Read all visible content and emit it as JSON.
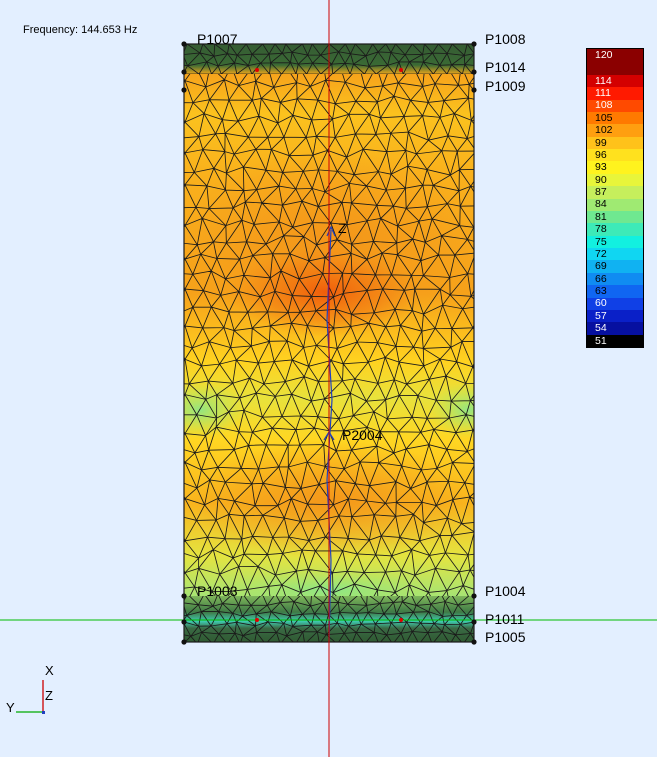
{
  "viewer": {
    "frequency_label": "Frequency: 144.653 Hz",
    "colors": {
      "background": "#e3efff",
      "mesh_line": "#1a1a1a",
      "crosshair_vertical": "#cc0000",
      "crosshair_horizontal": "#00bb00",
      "axis_line": "#2040c0",
      "hot": "#f26a10",
      "warm": "#f59a1a",
      "mid": "#ffd21e",
      "cool": "#c8e64a",
      "cold": "#7fe58a",
      "band_dark": "#2f5a32"
    }
  },
  "points": [
    {
      "name": "P1007"
    },
    {
      "name": "P1008"
    },
    {
      "name": "P1014"
    },
    {
      "name": "P1009"
    },
    {
      "name": "Z"
    },
    {
      "name": "P2004"
    },
    {
      "name": "P1003"
    },
    {
      "name": "P1004"
    },
    {
      "name": "P1011"
    },
    {
      "name": "P1005"
    }
  ],
  "legend": {
    "entries": [
      {
        "label": "120",
        "color": "#8b0000",
        "text_color": "#ffffff"
      },
      {
        "label": "114",
        "color": "#d40000",
        "text_color": "#ffffff"
      },
      {
        "label": "111",
        "color": "#ff1a00",
        "text_color": "#ffffff"
      },
      {
        "label": "108",
        "color": "#ff4a00",
        "text_color": "#ffffff"
      },
      {
        "label": "105",
        "color": "#ff7a00",
        "text_color": "#000000"
      },
      {
        "label": "102",
        "color": "#ff9f10",
        "text_color": "#000000"
      },
      {
        "label": "99",
        "color": "#ffc21a",
        "text_color": "#000000"
      },
      {
        "label": "96",
        "color": "#ffe11e",
        "text_color": "#000000"
      },
      {
        "label": "93",
        "color": "#fff31e",
        "text_color": "#000000"
      },
      {
        "label": "90",
        "color": "#e8f53a",
        "text_color": "#000000"
      },
      {
        "label": "87",
        "color": "#c6ef5c",
        "text_color": "#000000"
      },
      {
        "label": "84",
        "color": "#9fea72",
        "text_color": "#000000"
      },
      {
        "label": "81",
        "color": "#6fe890",
        "text_color": "#000000"
      },
      {
        "label": "78",
        "color": "#3deab8",
        "text_color": "#000000"
      },
      {
        "label": "75",
        "color": "#12f0e0",
        "text_color": "#000000"
      },
      {
        "label": "72",
        "color": "#10d6f2",
        "text_color": "#000000"
      },
      {
        "label": "69",
        "color": "#10b2f2",
        "text_color": "#000000"
      },
      {
        "label": "66",
        "color": "#108cf2",
        "text_color": "#000000"
      },
      {
        "label": "63",
        "color": "#1066f2",
        "text_color": "#000000"
      },
      {
        "label": "60",
        "color": "#1040e6",
        "text_color": "#ffffff"
      },
      {
        "label": "57",
        "color": "#0a20c8",
        "text_color": "#ffffff"
      },
      {
        "label": "54",
        "color": "#0610a0",
        "text_color": "#ffffff"
      },
      {
        "label": "51",
        "color": "#000000",
        "text_color": "#ffffff"
      }
    ]
  },
  "triad": {
    "x_label": "X",
    "y_label": "Y",
    "z_label": "Z"
  }
}
